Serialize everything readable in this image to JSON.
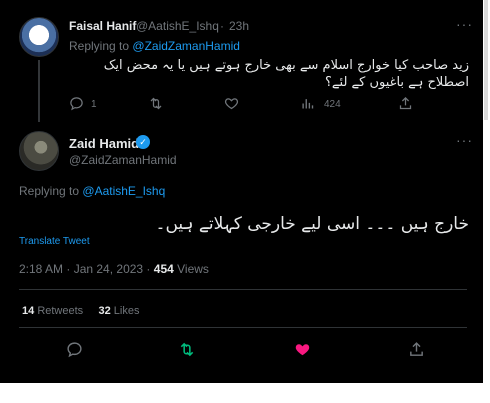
{
  "reply": {
    "name": "Faisal Hanif",
    "handle": "@AatishE_Ishq",
    "separator": "·",
    "time": "23h",
    "replying_label": "Replying to",
    "replying_handle": "@ZaidZamanHamid",
    "text": "زید صاحب کیا خوارج اسلام سے بھی خارج ہوتے ہیں یا یہ محض ایک اصطلاح ہے باغیوں کے لئے؟",
    "actions": {
      "reply_icon": "comment-icon",
      "reply_count": "1",
      "retweet_icon": "retweet-icon",
      "like_icon": "heart-icon",
      "views_icon": "analytics-icon",
      "views_count": "424",
      "share_icon": "share-icon"
    }
  },
  "main": {
    "name": "Zaid Hamid",
    "verified_icon": "verified-badge-icon",
    "handle": "@ZaidZamanHamid",
    "replying_label": "Replying to",
    "replying_handle": "@AatishE_Ishq",
    "text": "خارج ہیں ۔۔۔ اسی لیے خارجی کہلاتے ہیں۔",
    "translate": "Translate Tweet",
    "time": "2:18 AM · Jan 24, 2023 ·",
    "views_number": "454",
    "views_label": "Views",
    "retweets_number": "14",
    "retweets_label": "Retweets",
    "likes_number": "32",
    "likes_label": "Likes",
    "bar": {
      "reply_icon": "comment-icon",
      "retweet_icon": "retweet-icon",
      "like_icon": "heart-filled-icon",
      "share_icon": "share-icon"
    }
  },
  "colors": {
    "background": "#000000",
    "text": "#e7e9ea",
    "muted": "#71767b",
    "accent": "#1d9bf0",
    "retweet_active": "#00ba7c",
    "like_active": "#f91880",
    "divider": "#2f3336"
  }
}
